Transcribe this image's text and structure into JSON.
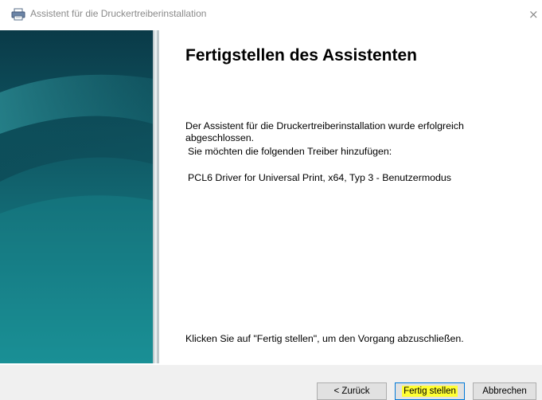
{
  "window": {
    "title": "Assistent für die Druckertreiberinstallation",
    "close_glyph": "×",
    "printer_icon": "printer-icon"
  },
  "content": {
    "heading": "Fertigstellen des Assistenten",
    "line1": "Der Assistent für die Druckertreiberinstallation wurde erfolgreich abgeschlossen.",
    "line2": "Sie möchten die folgenden Treiber hinzufügen:",
    "driver": "PCL6 Driver for Universal Print, x64, Typ 3 - Benutzermodus",
    "instruction": "Klicken Sie auf \"Fertig stellen\", um den Vorgang abzuschließen."
  },
  "buttons": {
    "back": "< Zurück",
    "finish": "Fertig stellen",
    "cancel": "Abbrechen"
  },
  "colors": {
    "banner_top": "#0e3f4c",
    "banner_mid": "#136a75",
    "banner_bottom": "#1b8f96",
    "finish_highlight": "#ffff33",
    "footer_bg": "#f0f0f0"
  }
}
